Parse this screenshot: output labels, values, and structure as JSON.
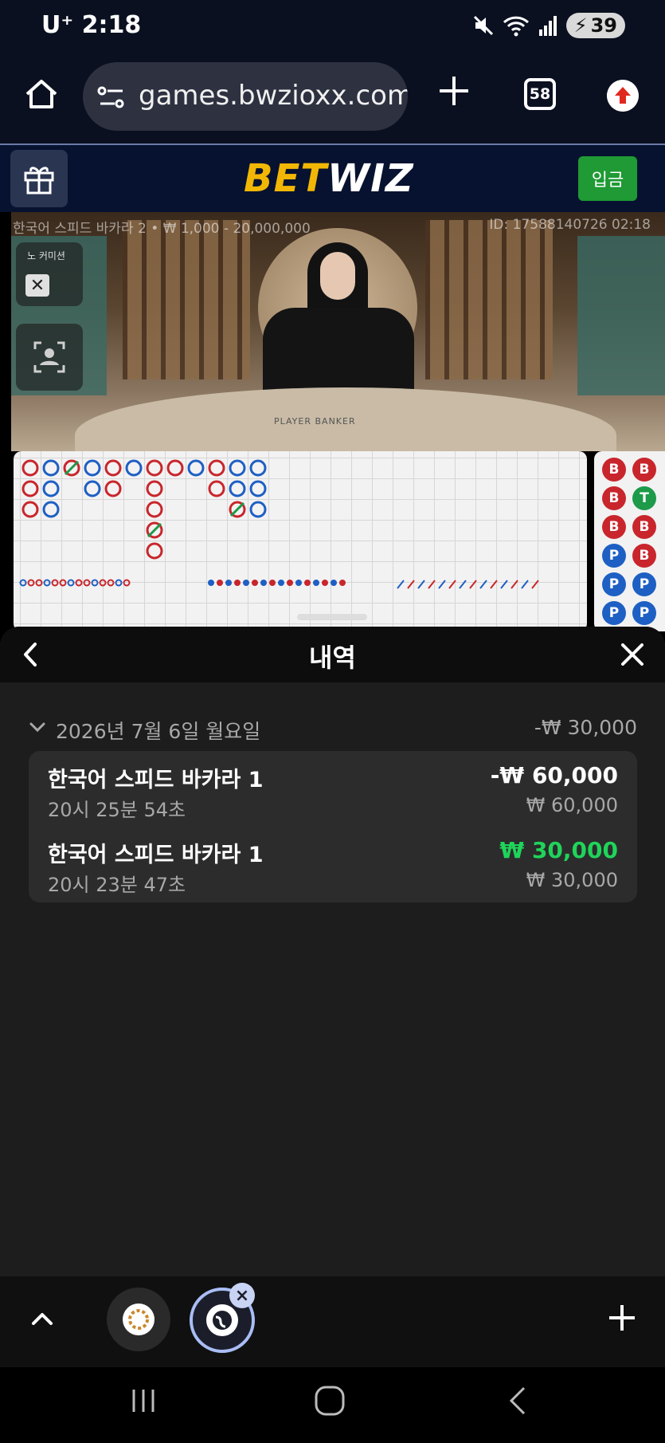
{
  "status_bar": {
    "carrier": "U⁺",
    "time": "2:18",
    "battery": "39"
  },
  "browser": {
    "url": "games.bwzioxx.com/",
    "tab_count": "58"
  },
  "site": {
    "logo_part1": "BET",
    "logo_part2": "WIZ",
    "deposit_label": "입금"
  },
  "game": {
    "caption": "한국어 스피드 바카라 2 • ₩ 1,000 - 20,000,000",
    "round_id": "ID: 17588140726 02:18",
    "no_commission_label": "노 커미션",
    "table_label": "PLAYER  BANKER"
  },
  "bead_road": [
    [
      "B",
      "B"
    ],
    [
      "B",
      "T"
    ],
    [
      "B",
      "B"
    ],
    [
      "P",
      "B"
    ],
    [
      "P",
      "P"
    ],
    [
      "P",
      "P"
    ]
  ],
  "history": {
    "title": "내역",
    "date": "2026년 7월 6일 월요일",
    "date_total": "-₩ 30,000",
    "transactions": [
      {
        "game": "한국어 스피드 바카라 1",
        "time": "20시 25분 54초",
        "amount": "-₩ 60,000",
        "stake": "₩ 60,000",
        "result": "loss"
      },
      {
        "game": "한국어 스피드 바카라 1",
        "time": "20시 23분 47초",
        "amount": "₩ 30,000",
        "stake": "₩ 30,000",
        "result": "win"
      }
    ]
  },
  "colors": {
    "win": "#1fd45a",
    "loss": "#ffffff",
    "banker": "#c8262c",
    "player": "#1e5fc4",
    "tie": "#1d9a4a"
  }
}
